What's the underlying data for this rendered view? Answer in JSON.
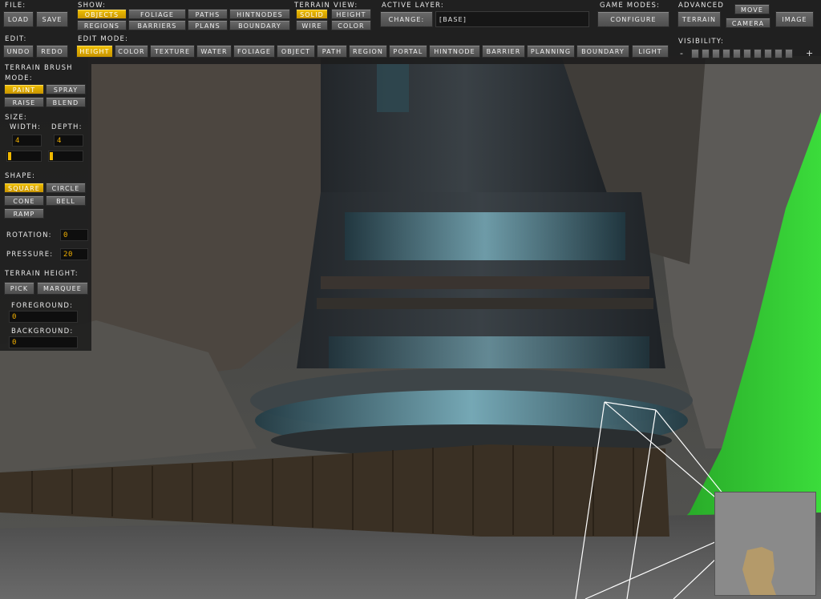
{
  "file": {
    "label": "FILE:",
    "load": "LOAD",
    "save": "SAVE"
  },
  "show": {
    "label": "SHOW:",
    "buttons": [
      "OBJECTS",
      "FOLIAGE",
      "PATHS",
      "HINTNODES",
      "REGIONS",
      "BARRIERS",
      "PLANS",
      "BOUNDARY"
    ],
    "active": "OBJECTS"
  },
  "terrain_view": {
    "label": "TERRAIN VIEW:",
    "buttons": [
      "SOLID",
      "HEIGHT",
      "WIRE",
      "COLOR"
    ],
    "active": "SOLID"
  },
  "active_layer": {
    "label": "ACTIVE LAYER:",
    "change": "CHANGE:",
    "value": "[BASE]"
  },
  "game_modes": {
    "label": "GAME MODES:",
    "configure": "CONFIGURE"
  },
  "advanced": {
    "label": "ADVANCED",
    "terrain": "TERRAIN",
    "move": "MOVE",
    "camera": "CAMERA",
    "image": "IMAGE"
  },
  "edit": {
    "label": "EDIT:",
    "undo": "UNDO",
    "redo": "REDO"
  },
  "edit_mode": {
    "label": "EDIT MODE:",
    "buttons": [
      "HEIGHT",
      "COLOR",
      "TEXTURE",
      "WATER",
      "FOLIAGE",
      "OBJECT",
      "PATH",
      "REGION",
      "PORTAL",
      "HINTNODE",
      "BARRIER",
      "PLANNING",
      "BOUNDARY",
      "LIGHT"
    ],
    "active": "HEIGHT"
  },
  "visibility": {
    "label": "VISIBILITY:",
    "minus": "-",
    "plus": "+",
    "segments": 10
  },
  "brush": {
    "title": "TERRAIN BRUSH",
    "mode_label": "MODE:",
    "modes": [
      "PAINT",
      "SPRAY",
      "RAISE",
      "BLEND"
    ],
    "mode_active": "PAINT",
    "size_label": "SIZE:",
    "width_label": "WIDTH:",
    "depth_label": "DEPTH:",
    "width": "4",
    "depth": "4",
    "shape_label": "SHAPE:",
    "shapes": [
      "SQUARE",
      "CIRCLE",
      "CONE",
      "BELL",
      "RAMP"
    ],
    "shape_active": "SQUARE",
    "rotation_label": "ROTATION:",
    "rotation": "0",
    "pressure_label": "PRESSURE:",
    "pressure": "20",
    "height_label": "TERRAIN HEIGHT:",
    "pick": "PICK",
    "marquee": "MARQUEE",
    "foreground_label": "FOREGROUND:",
    "foreground": "0",
    "background_label": "BACKGROUND:",
    "background": "0"
  },
  "colors": {
    "accent": "#f0b800",
    "panel": "#1c1c1c",
    "button": "#5a5a5a",
    "terrain_green": "#2ecc2e"
  }
}
